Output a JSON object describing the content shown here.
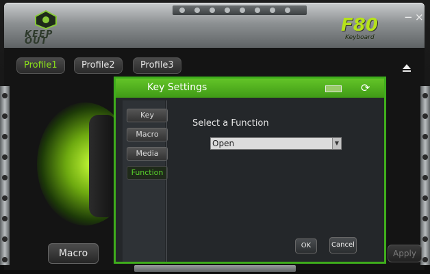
{
  "header": {
    "logo_text": "KEEP OUT",
    "brand_model": "F80",
    "brand_sub": "Keyboard",
    "minimize_label": "−",
    "close_label": "×"
  },
  "profiles": {
    "tabs": [
      {
        "label": "Profile1",
        "active": true
      },
      {
        "label": "Profile2",
        "active": false
      },
      {
        "label": "Profile3",
        "active": false
      }
    ]
  },
  "bottom": {
    "macro_label": "Macro",
    "apply_label": "Apply"
  },
  "dialog": {
    "title": "Key Settings",
    "sidebar": [
      "Key",
      "Macro",
      "Media",
      "Function"
    ],
    "active_item": "Function",
    "function_label": "Select a Function",
    "selected_function": "Open",
    "ok_label": "OK",
    "cancel_label": "Cancel"
  },
  "colors": {
    "accent": "#58d02c",
    "title_bar": "#4fb01e",
    "brand": "#b6e21a"
  },
  "icons": [
    "eject-icon",
    "keyboard-icon",
    "refresh-icon",
    "dropdown-arrow-icon"
  ]
}
